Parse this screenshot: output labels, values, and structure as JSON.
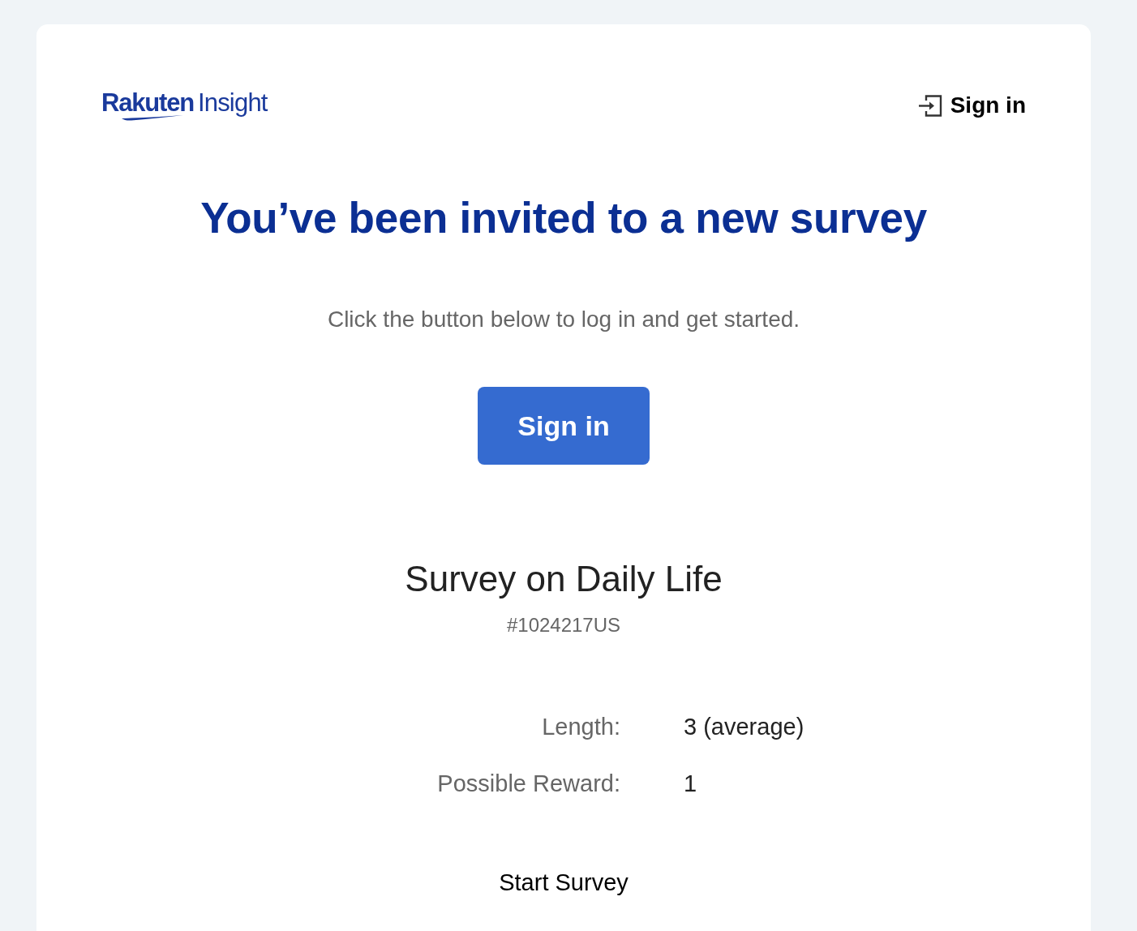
{
  "header": {
    "logo": {
      "brand": "Rakuten",
      "product": "Insight"
    },
    "sign_in_link": "Sign in"
  },
  "invitation": {
    "heading": "You’ve been invited to a new survey",
    "message": "Click the button below to log in and get started.",
    "button": "Sign in"
  },
  "survey": {
    "title": "Survey on Daily Life",
    "id": "#1024217US",
    "details": [
      {
        "label": "Length:",
        "value": "3 (average)"
      },
      {
        "label": "Possible Reward:",
        "value": "1"
      }
    ],
    "start_link": "Start Survey"
  }
}
